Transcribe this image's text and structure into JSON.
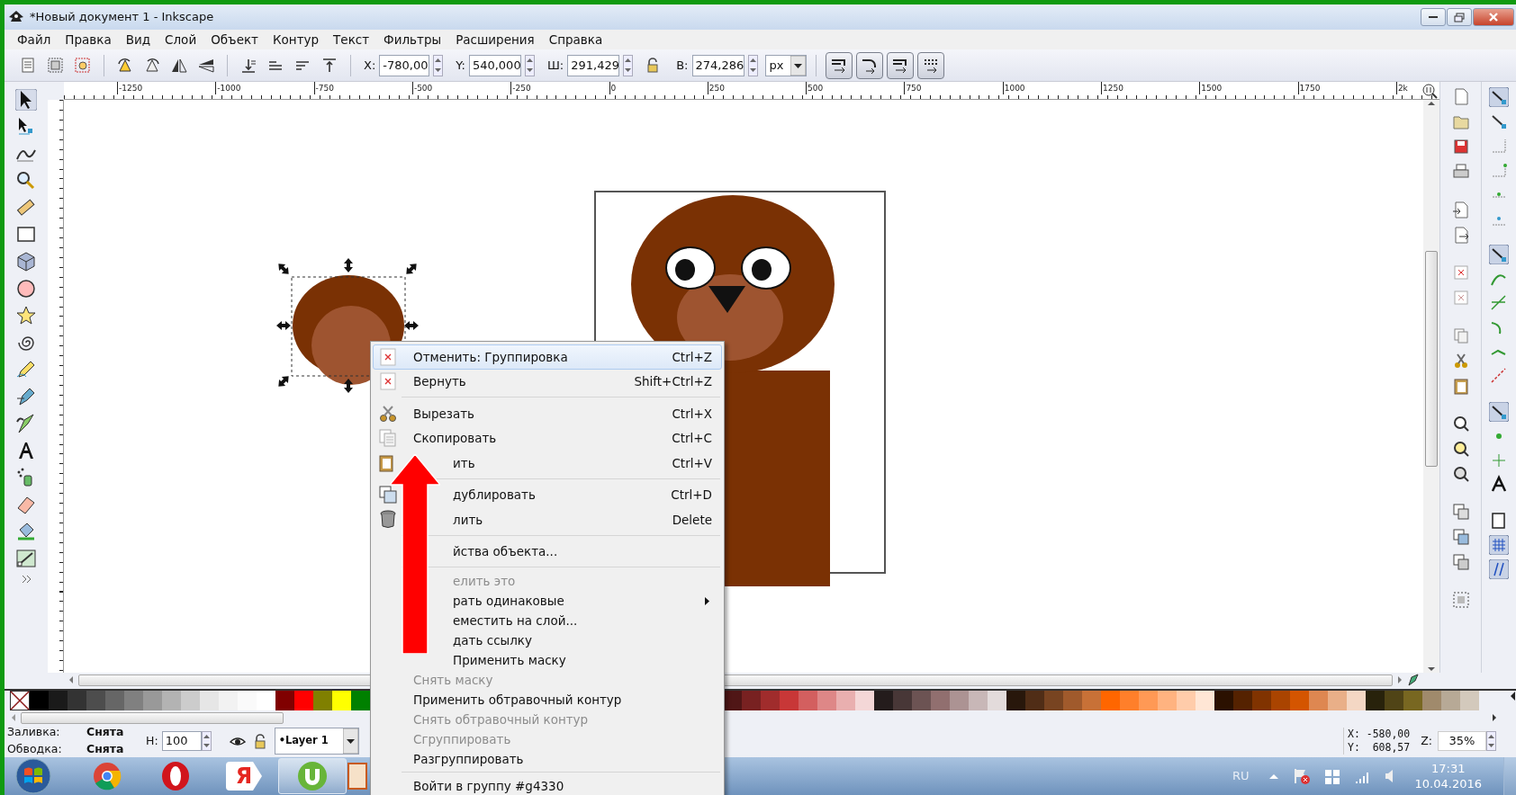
{
  "window": {
    "title": "*Новый документ 1 - Inkscape"
  },
  "menu_bar": [
    {
      "label": "Файл"
    },
    {
      "label": "Правка"
    },
    {
      "label": "Вид"
    },
    {
      "label": "Слой"
    },
    {
      "label": "Объект"
    },
    {
      "label": "Контур"
    },
    {
      "label": "Текст"
    },
    {
      "label": "Фильтры"
    },
    {
      "label": "Расширения"
    },
    {
      "label": "Справка"
    }
  ],
  "toolbar": {
    "fields": [
      {
        "label": "X:",
        "value": "-780,00"
      },
      {
        "label": "Y:",
        "value": "540,000"
      },
      {
        "label": "Ш:",
        "value": "291,429"
      },
      {
        "label": "В:",
        "value": "274,286"
      }
    ],
    "unit": "px"
  },
  "ruler": {
    "labels": [
      "-1250",
      "-1000",
      "-750",
      "-500",
      "-250",
      "0",
      "250",
      "500",
      "750",
      "1000",
      "1250",
      "1500",
      "1750",
      "2k"
    ]
  },
  "context_menu": {
    "items": [
      {
        "kind": "undo",
        "label": "Отменить: Группировка",
        "shortcut": "Ctrl+Z",
        "disabled": false,
        "selected": true
      },
      {
        "kind": "redo",
        "label": "Вернуть",
        "shortcut": "Shift+Ctrl+Z",
        "disabled": false,
        "selected": false
      },
      {
        "kind": "separator"
      },
      {
        "kind": "cut",
        "label": "Вырезать",
        "shortcut": "Ctrl+X",
        "disabled": false,
        "selected": false
      },
      {
        "kind": "copy",
        "label": "Скопировать",
        "shortcut": "Ctrl+C",
        "disabled": false,
        "selected": false
      },
      {
        "kind": "paste",
        "label": "ить",
        "shortcut": "Ctrl+V",
        "disabled": false,
        "selected": false
      },
      {
        "kind": "separator"
      },
      {
        "kind": "duplicate",
        "label": "дублировать",
        "shortcut": "Ctrl+D",
        "disabled": false,
        "selected": false
      },
      {
        "kind": "delete",
        "label": "лить",
        "shortcut": "Delete",
        "disabled": false,
        "selected": false
      },
      {
        "kind": "separator"
      },
      {
        "kind": "tall",
        "label": "йства объекта...",
        "disabled": false,
        "selected": false
      },
      {
        "kind": "separator"
      },
      {
        "kind": "plain",
        "label": "елить это",
        "disabled": true,
        "selected": false
      },
      {
        "kind": "plain",
        "label": "рать одинаковые",
        "disabled": false,
        "selected": false,
        "submenu": true
      },
      {
        "kind": "plain",
        "label": "еместить на слой...",
        "disabled": false,
        "selected": false
      },
      {
        "kind": "plain",
        "label": "дать ссылку",
        "disabled": false,
        "selected": false
      },
      {
        "kind": "plain",
        "label": "Применить маску",
        "disabled": false,
        "selected": false
      },
      {
        "kind": "plain",
        "label": "Снять маску",
        "disabled": true,
        "selected": false
      },
      {
        "kind": "plain",
        "label": "Применить обтравочный контур",
        "disabled": false,
        "selected": false
      },
      {
        "kind": "plain",
        "label": "Снять обтравочный контур",
        "disabled": true,
        "selected": false
      },
      {
        "kind": "plain",
        "label": "Сгруппировать",
        "disabled": true,
        "selected": false
      },
      {
        "kind": "plain",
        "label": "Разгруппировать",
        "disabled": false,
        "selected": false
      },
      {
        "kind": "separator"
      },
      {
        "kind": "plain",
        "label": "Войти в группу #g4330",
        "disabled": false,
        "selected": false
      }
    ]
  },
  "palette": {
    "left": [
      {
        "color": "#000000"
      },
      {
        "color": "#1a1a1a"
      },
      {
        "color": "#333333"
      },
      {
        "color": "#4d4d4d"
      },
      {
        "color": "#666666"
      },
      {
        "color": "#808080"
      },
      {
        "color": "#999999"
      },
      {
        "color": "#b3b3b3"
      },
      {
        "color": "#cccccc"
      },
      {
        "color": "#e6e6e6"
      },
      {
        "color": "#f2f2f2"
      },
      {
        "color": "#fafafa"
      },
      {
        "color": "#ffffff"
      },
      {
        "color": "#800000"
      },
      {
        "color": "#ff0000"
      },
      {
        "color": "#808000"
      },
      {
        "color": "#ffff00"
      },
      {
        "color": "#008000"
      }
    ],
    "right": [
      {
        "color": "#501616"
      },
      {
        "color": "#782121"
      },
      {
        "color": "#a02c2c"
      },
      {
        "color": "#c83737"
      },
      {
        "color": "#d35f5f"
      },
      {
        "color": "#de8787"
      },
      {
        "color": "#e9afaf"
      },
      {
        "color": "#f4d7d7"
      },
      {
        "color": "#241c1c"
      },
      {
        "color": "#483737"
      },
      {
        "color": "#6c5353"
      },
      {
        "color": "#916f6f"
      },
      {
        "color": "#ac9393"
      },
      {
        "color": "#c8b7b7"
      },
      {
        "color": "#e3dbdb"
      },
      {
        "color": "#28170b"
      },
      {
        "color": "#502d16"
      },
      {
        "color": "#784421"
      },
      {
        "color": "#a05a2c"
      },
      {
        "color": "#c87137"
      },
      {
        "color": "#ff6600"
      },
      {
        "color": "#ff7f2a"
      },
      {
        "color": "#ff9955"
      },
      {
        "color": "#ffb380"
      },
      {
        "color": "#ffccaa"
      },
      {
        "color": "#ffe6d5"
      },
      {
        "color": "#2b1100"
      },
      {
        "color": "#552200"
      },
      {
        "color": "#803300"
      },
      {
        "color": "#aa4400"
      },
      {
        "color": "#d45500"
      },
      {
        "color": "#de8751"
      },
      {
        "color": "#e9af88"
      },
      {
        "color": "#f4d7c4"
      },
      {
        "color": "#28220b"
      },
      {
        "color": "#504416"
      },
      {
        "color": "#786721"
      },
      {
        "color": "#a08a6c"
      },
      {
        "color": "#b7a996"
      },
      {
        "color": "#d3c9bc"
      }
    ]
  },
  "status_bar": {
    "fill_label": "Заливка:",
    "fill_value": "Снята",
    "stroke_label": "Обводка:",
    "stroke_value": "Снята",
    "opacity_label": "Н:",
    "opacity_value": "100",
    "layer": "•Layer 1",
    "cursor_x": "X: -580,00",
    "cursor_y": "Y:  608,57",
    "zoom_label": "Z:",
    "zoom_value": "35%"
  },
  "taskbar": {
    "apps": [
      {
        "kind": "chrome",
        "selected": false
      },
      {
        "kind": "opera",
        "selected": false
      },
      {
        "kind": "yandex",
        "glyph": "Я",
        "selected": false
      },
      {
        "kind": "utorrent",
        "selected": true
      },
      {
        "kind": "document",
        "selected": false
      }
    ],
    "language": "RU",
    "time": "17:31",
    "date": "10.04.2016"
  }
}
